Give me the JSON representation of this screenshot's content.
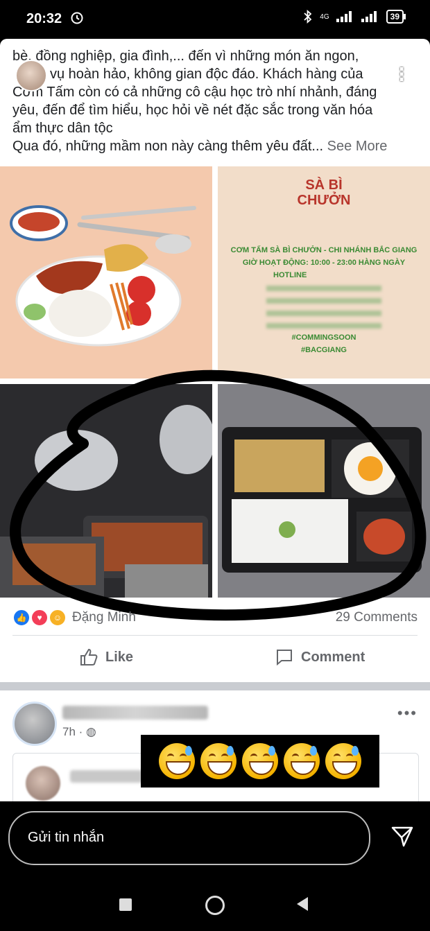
{
  "status_bar": {
    "time": "20:32",
    "network": "4G",
    "battery": "39"
  },
  "post": {
    "text_lines": [
      "bè, đồng nghiệp, gia đình,... đến vì những món ăn ngon,",
      "vụ hoàn hảo, không gian độc đáo. Khách hàng của",
      "Cơm Tấm còn có cả những cô cậu học trò nhí nhảnh, đáng",
      "yêu, đến để tìm hiểu, học hỏi về nét đặc sắc trong văn hóa",
      "ẩm thực dân tộc"
    ],
    "last_line": "Qua đó, những mầm non này càng thêm yêu đất...",
    "see_more": "See More",
    "shop_logo_line1": "SÀ BÌ",
    "shop_logo_line2": "CHƯỞN",
    "shop_info": [
      "CƠM TẤM SÀ BÌ CHƯỞN - CHI NHÁNH BẮC GIANG",
      "GIỜ HOẠT ĐỘNG: 10:00 - 23:00 HÀNG NGÀY",
      "HOTLINE",
      "#COMMINGSOON",
      "#BACGIANG"
    ],
    "reaction_name": "Đặng Minh",
    "comments": "29 Comments",
    "like_label": "Like",
    "comment_label": "Comment"
  },
  "post2": {
    "time": "7h ·"
  },
  "reply": {
    "placeholder": "Gửi tin nhắn"
  },
  "colors": {
    "accent": "#1877f2",
    "logo_red": "#b8352b",
    "info_green": "#3a8a33"
  }
}
